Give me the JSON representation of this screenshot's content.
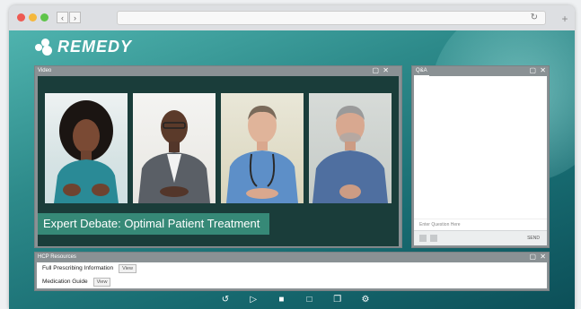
{
  "browser": {
    "traffic_lights": [
      "#ee5a52",
      "#f5b83d",
      "#5fc44a"
    ],
    "back_icon": "chevron-left-icon",
    "forward_icon": "chevron-right-icon",
    "reload_icon": "reload-icon",
    "newtab_icon": "plus-icon"
  },
  "app": {
    "brand": "REMEDY",
    "accent": "#2d8a8a"
  },
  "video_panel": {
    "title": "Video",
    "banner_prefix": "Expert Debate:",
    "banner_rest": " Optimal Patient Treatment",
    "participants": [
      {
        "name": "participant-1"
      },
      {
        "name": "participant-2"
      },
      {
        "name": "participant-3"
      },
      {
        "name": "participant-4"
      }
    ]
  },
  "qa_panel": {
    "title": "Q&A",
    "placeholder": "Enter Question Here",
    "send_label": "SEND"
  },
  "resources_panel": {
    "title": "HCP Resources",
    "items": [
      {
        "label": "Full Prescribing Information",
        "button": "View"
      },
      {
        "label": "Medication Guide",
        "button": "View"
      }
    ]
  },
  "toolbar": {
    "icons": [
      "replay-icon",
      "video-icon",
      "chat-icon",
      "bookmark-icon",
      "slides-icon",
      "settings-icon"
    ]
  }
}
